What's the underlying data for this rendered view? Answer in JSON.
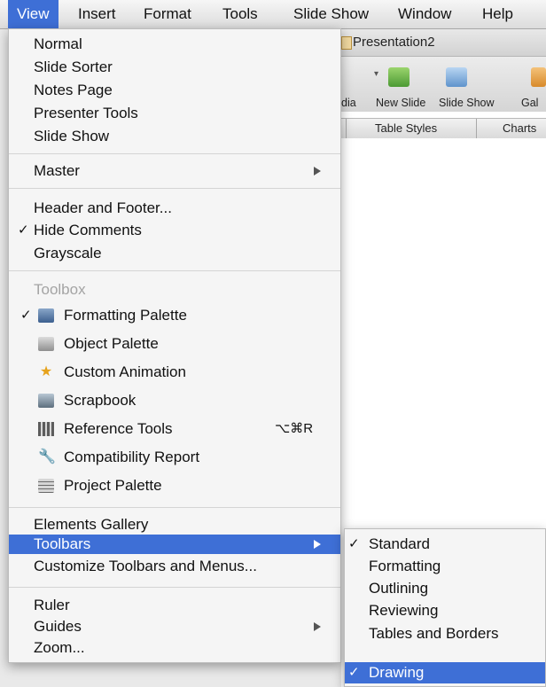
{
  "menubar": {
    "items": [
      "View",
      "Insert",
      "Format",
      "Tools",
      "Slide Show",
      "Window",
      "Help"
    ]
  },
  "window": {
    "title": "Presentation2",
    "toolbar": {
      "labels": [
        "dia",
        "New Slide",
        "Slide Show",
        "Gal"
      ]
    },
    "ribbon": {
      "tabs": [
        "Table Styles",
        "Charts"
      ]
    }
  },
  "view_menu": {
    "items": [
      {
        "label": "Normal"
      },
      {
        "label": "Slide Sorter"
      },
      {
        "label": "Notes Page"
      },
      {
        "label": "Presenter Tools"
      },
      {
        "label": "Slide Show"
      },
      {
        "label": "Master"
      },
      {
        "label": "Header and Footer..."
      },
      {
        "label": "Hide Comments",
        "check": "✓"
      },
      {
        "label": "Grayscale"
      },
      {
        "label": "Toolbox"
      },
      {
        "label": "Formatting Palette",
        "check": "✓"
      },
      {
        "label": "Object Palette"
      },
      {
        "label": "Custom Animation"
      },
      {
        "label": "Scrapbook"
      },
      {
        "label": "Reference Tools",
        "shortcut": "⌥⌘R"
      },
      {
        "label": "Compatibility Report"
      },
      {
        "label": "Project Palette"
      },
      {
        "label": "Elements Gallery"
      },
      {
        "label": "Toolbars"
      },
      {
        "label": "Customize Toolbars and Menus..."
      },
      {
        "label": "Ruler"
      },
      {
        "label": "Guides"
      },
      {
        "label": "Zoom..."
      }
    ]
  },
  "toolbars_submenu": {
    "items": [
      {
        "label": "Standard",
        "check": "✓"
      },
      {
        "label": "Formatting"
      },
      {
        "label": "Outlining"
      },
      {
        "label": "Reviewing"
      },
      {
        "label": "Tables and Borders"
      },
      {
        "label": "Drawing",
        "check": "✓"
      }
    ]
  },
  "colors": {
    "highlight": "#3e6fd6"
  }
}
